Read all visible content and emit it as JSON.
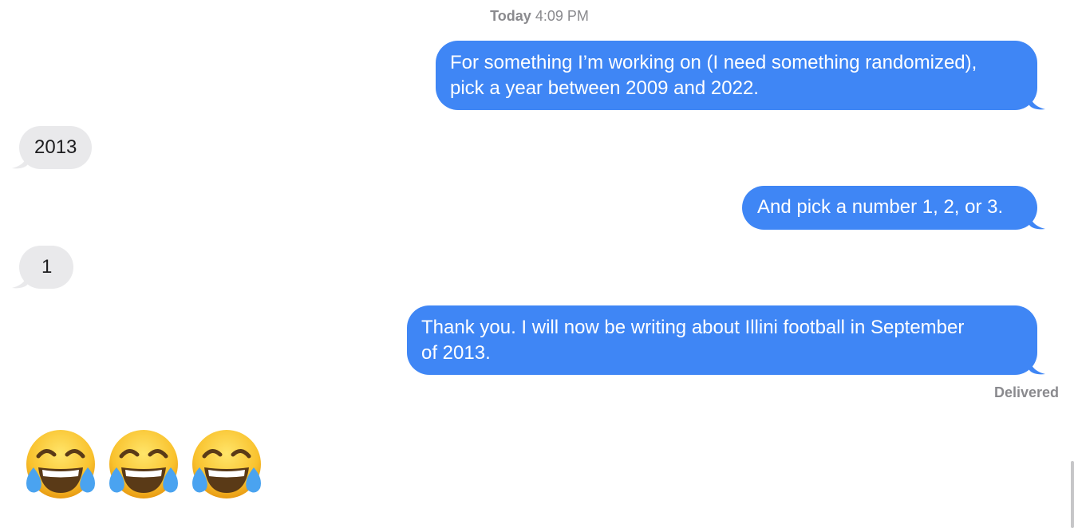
{
  "conversation": {
    "timestamp_day": "Today",
    "timestamp_time": "4:09 PM",
    "messages": [
      {
        "direction": "outgoing",
        "lines": [
          "For something I’m working on (I need something randomized),",
          "pick a year between 2009 and 2022."
        ]
      },
      {
        "direction": "incoming",
        "lines": [
          "2013"
        ]
      },
      {
        "direction": "outgoing",
        "lines": [
          "And pick a number 1, 2, or 3."
        ]
      },
      {
        "direction": "incoming",
        "lines": [
          "1"
        ]
      },
      {
        "direction": "outgoing",
        "lines": [
          "Thank you. I will now be writing about Illini football in September",
          "of 2013."
        ]
      }
    ],
    "delivery_status": "Delivered",
    "reaction_emojis": [
      "face-with-tears-of-joy-icon",
      "face-with-tears-of-joy-icon",
      "face-with-tears-of-joy-icon"
    ]
  },
  "colors": {
    "outgoing_bubble": "#3f86f5",
    "incoming_bubble": "#e9e9eb",
    "meta_text": "#8a8a8e"
  }
}
